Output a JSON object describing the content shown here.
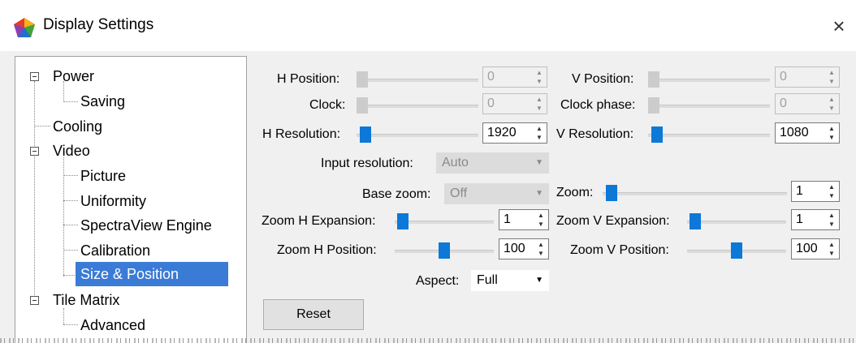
{
  "window": {
    "title": "Display Settings",
    "close_glyph": "×",
    "app_icon": "color-palette-icon"
  },
  "tree": {
    "items": [
      {
        "label": "Power"
      },
      {
        "label": "Saving"
      },
      {
        "label": "Cooling"
      },
      {
        "label": "Video"
      },
      {
        "label": "Picture"
      },
      {
        "label": "Uniformity"
      },
      {
        "label": "SpectraView Engine"
      },
      {
        "label": "Calibration"
      },
      {
        "label": "Size & Position",
        "selected": true
      },
      {
        "label": "Tile Matrix"
      },
      {
        "label": "Advanced"
      }
    ]
  },
  "form": {
    "h_position": {
      "label": "H Position:",
      "value": "0",
      "enabled": false
    },
    "v_position": {
      "label": "V Position:",
      "value": "0",
      "enabled": false
    },
    "clock": {
      "label": "Clock:",
      "value": "0",
      "enabled": false
    },
    "clock_phase": {
      "label": "Clock phase:",
      "value": "0",
      "enabled": false
    },
    "h_resolution": {
      "label": "H Resolution:",
      "value": "1920",
      "enabled": true
    },
    "v_resolution": {
      "label": "V Resolution:",
      "value": "1080",
      "enabled": true
    },
    "input_resolution": {
      "label": "Input resolution:",
      "value": "Auto",
      "enabled": false
    },
    "base_zoom": {
      "label": "Base zoom:",
      "value": "Off",
      "enabled": false
    },
    "zoom": {
      "label": "Zoom:",
      "value": "1"
    },
    "zoom_h_expansion": {
      "label": "Zoom H Expansion:",
      "value": "1"
    },
    "zoom_v_expansion": {
      "label": "Zoom V Expansion:",
      "value": "1"
    },
    "zoom_h_position": {
      "label": "Zoom H Position:",
      "value": "100"
    },
    "zoom_v_position": {
      "label": "Zoom V Position:",
      "value": "100"
    },
    "aspect": {
      "label": "Aspect:",
      "value": "Full"
    },
    "reset_label": "Reset"
  },
  "colors": {
    "accent": "#0c78d8",
    "selection": "#3a7bd5"
  }
}
